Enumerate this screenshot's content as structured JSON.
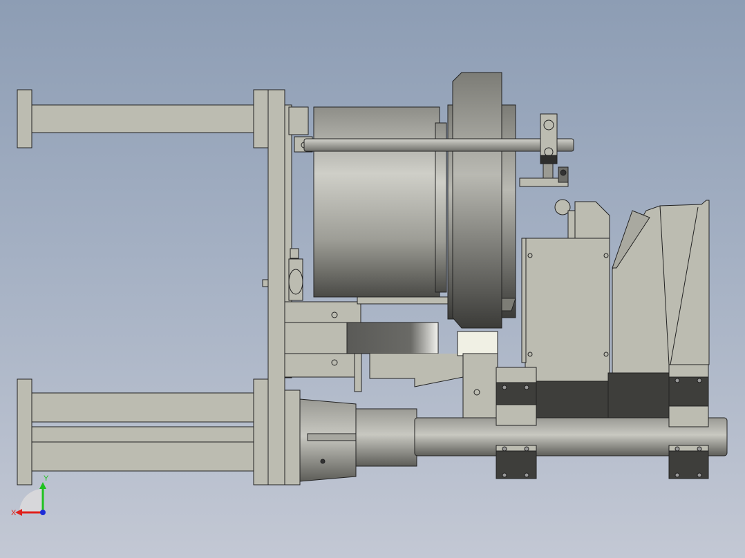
{
  "viewport": {
    "background_top": "#8d9db4",
    "background_bottom": "#c3c8d4"
  },
  "model": {
    "part_color": "#bcbcb1",
    "dark_block_color": "#3e3e3b",
    "edge_color": "#222222"
  },
  "triad": {
    "x_label": "X",
    "y_label": "Y",
    "x_color": "#e0201c",
    "y_color": "#1ec21e",
    "z_color": "#1c2cd8"
  }
}
